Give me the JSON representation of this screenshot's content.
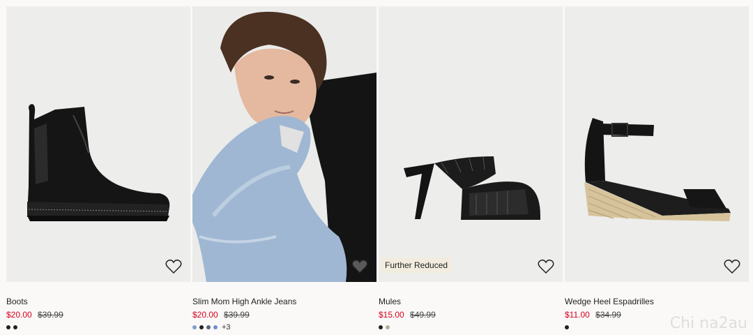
{
  "products": [
    {
      "name": "Boots",
      "price": "$20.00",
      "old_price": "$39.99",
      "badge": "",
      "swatches": [
        "#222222",
        "#222222"
      ],
      "more": ""
    },
    {
      "name": "Slim Mom High Ankle Jeans",
      "price": "$20.00",
      "old_price": "$39.99",
      "badge": "",
      "swatches": [
        "#7fa0c8",
        "#222222",
        "#55657a",
        "#6f8fcf"
      ],
      "more": "+3"
    },
    {
      "name": "Mules",
      "price": "$15.00",
      "old_price": "$49.99",
      "badge": "Further Reduced",
      "swatches": [
        "#222222",
        "#b5ab9c"
      ],
      "more": ""
    },
    {
      "name": "Wedge Heel Espadrilles",
      "price": "$11.00",
      "old_price": "$34.99",
      "badge": "",
      "swatches": [
        "#222222"
      ],
      "more": ""
    }
  ],
  "watermark": "Chi na2au",
  "colors": {
    "sale_price": "#d6001c",
    "badge_bg": "#f2ecdf",
    "card_bg": "#ededec"
  }
}
